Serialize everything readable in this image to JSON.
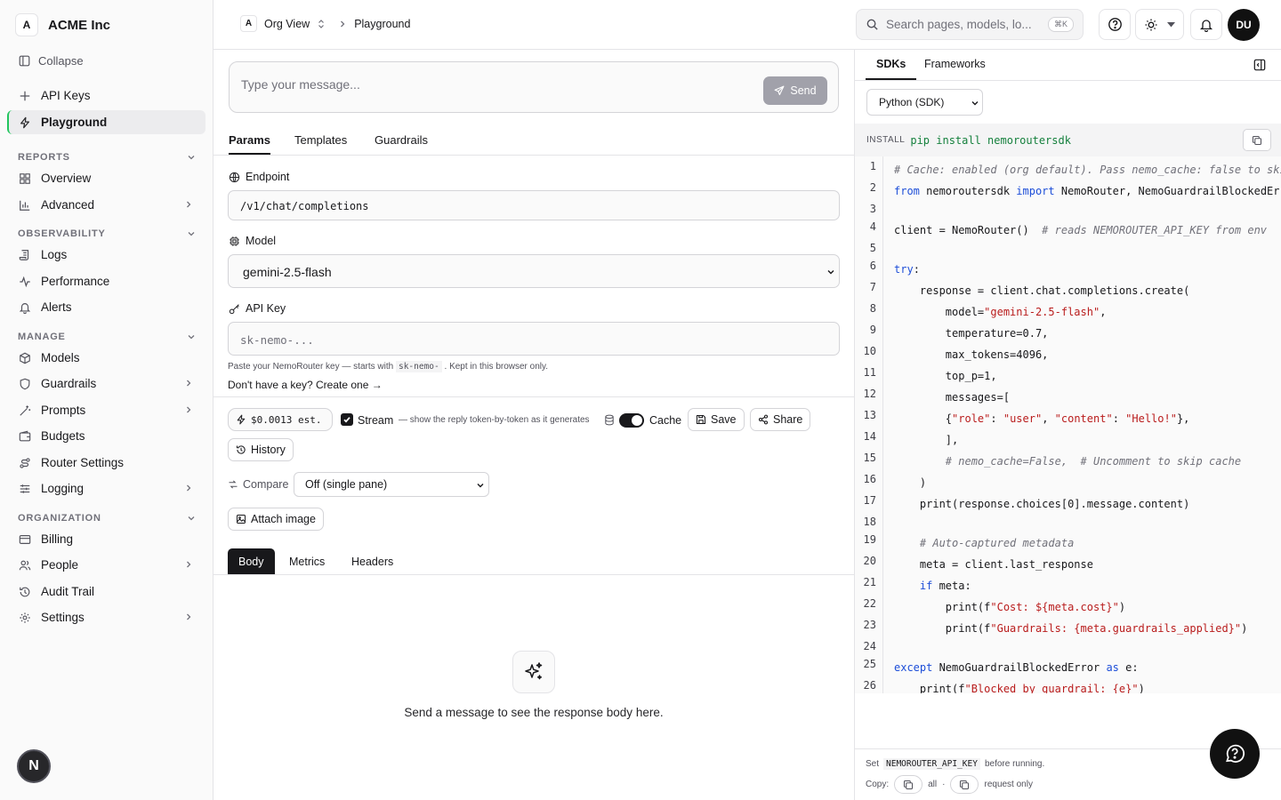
{
  "org": {
    "initial": "A",
    "name": "ACME Inc"
  },
  "sidebar": {
    "collapse_label": "Collapse",
    "top_items": [
      {
        "label": "API Keys",
        "icon": "plus-icon"
      },
      {
        "label": "Playground",
        "icon": "bolt-icon",
        "active": true
      }
    ],
    "sections": [
      {
        "title": "REPORTS",
        "items": [
          {
            "label": "Overview",
            "icon": "grid-icon"
          },
          {
            "label": "Advanced",
            "icon": "bar-chart-icon",
            "has_children": true
          }
        ]
      },
      {
        "title": "OBSERVABILITY",
        "items": [
          {
            "label": "Logs",
            "icon": "logs-icon"
          },
          {
            "label": "Performance",
            "icon": "activity-icon"
          },
          {
            "label": "Alerts",
            "icon": "bell-icon"
          }
        ]
      },
      {
        "title": "MANAGE",
        "items": [
          {
            "label": "Models",
            "icon": "cube-icon"
          },
          {
            "label": "Guardrails",
            "icon": "shield-icon",
            "has_children": true
          },
          {
            "label": "Prompts",
            "icon": "wand-icon",
            "has_children": true
          },
          {
            "label": "Budgets",
            "icon": "wallet-icon"
          },
          {
            "label": "Router Settings",
            "icon": "route-icon"
          },
          {
            "label": "Logging",
            "icon": "sliders-icon",
            "has_children": true
          }
        ]
      },
      {
        "title": "ORGANIZATION",
        "items": [
          {
            "label": "Billing",
            "icon": "card-icon"
          },
          {
            "label": "People",
            "icon": "users-icon",
            "has_children": true
          },
          {
            "label": "Audit Trail",
            "icon": "history-icon"
          },
          {
            "label": "Settings",
            "icon": "gear-icon",
            "has_children": true
          }
        ]
      }
    ],
    "footer_avatar": "N"
  },
  "topbar": {
    "org_badge": "A",
    "org_view": "Org View",
    "current_page": "Playground",
    "search_placeholder": "Search pages, models, lo...",
    "search_shortcut": "⌘K",
    "user_initials": "DU"
  },
  "composer": {
    "placeholder": "Type your message...",
    "send_label": "Send"
  },
  "params_tabs": [
    "Params",
    "Templates",
    "Guardrails"
  ],
  "endpoint": {
    "label": "Endpoint",
    "value": "/v1/chat/completions"
  },
  "model": {
    "label": "Model",
    "value": "gemini-2.5-flash"
  },
  "api_key": {
    "label": "API Key",
    "placeholder": "sk-nemo-...",
    "hint_before": "Paste your NemoRouter key — starts with",
    "hint_code": "sk-nemo-",
    "hint_after": ". Kept in this browser only.",
    "create_link": "Don't have a key? Create one →"
  },
  "toolbar": {
    "cost": "$0.0013 est.",
    "stream_label": "Stream",
    "stream_hint": "— show the reply token-by-token as it generates",
    "stream_checked": true,
    "cache_label": "Cache",
    "cache_on": true,
    "save_label": "Save",
    "share_label": "Share",
    "history_label": "History",
    "compare_label": "Compare",
    "compare_value": "Off (single pane)",
    "attach_label": "Attach image"
  },
  "response_tabs": [
    "Body",
    "Metrics",
    "Headers"
  ],
  "empty_state": "Send a message to see the response body here.",
  "right_panel": {
    "tabs": [
      "SDKs",
      "Frameworks"
    ],
    "sdk_value": "Python (SDK)",
    "install_label": "INSTALL",
    "install_cmd": "pip install nemoroutersdk",
    "code_lines": [
      "# Cache: enabled (org default). Pass nemo_cache: false to skip",
      "from nemoroutersdk import NemoRouter, NemoGuardrailBlockedError",
      "",
      "client = NemoRouter()  # reads NEMOROUTER_API_KEY from env",
      "",
      "try:",
      "    response = client.chat.completions.create(",
      "        model=\"gemini-2.5-flash\",",
      "        temperature=0.7,",
      "        max_tokens=4096,",
      "        top_p=1,",
      "        messages=[",
      "        {\"role\": \"user\", \"content\": \"Hello!\"},",
      "        ],",
      "        # nemo_cache=False,  # Uncomment to skip cache",
      "    )",
      "    print(response.choices[0].message.content)",
      "",
      "    # Auto-captured metadata",
      "    meta = client.last_response",
      "    if meta:",
      "        print(f\"Cost: ${meta.cost}\")",
      "        print(f\"Guardrails: {meta.guardrails_applied}\")",
      "",
      "except NemoGuardrailBlockedError as e:",
      "    print(f\"Blocked by guardrail: {e}\")"
    ],
    "footer_set": "Set",
    "footer_env": "NEMOROUTER_API_KEY",
    "footer_before": "before running.",
    "footer_copy": "Copy:",
    "copy_all": "all",
    "copy_sep": "·",
    "copy_request": "request only"
  }
}
